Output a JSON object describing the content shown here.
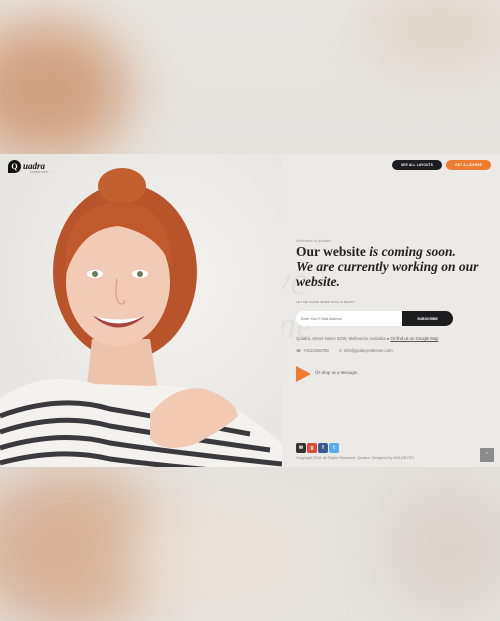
{
  "header": {
    "logo_mark": "Q",
    "logo_text": "uadra",
    "logo_sub": "COMING SOON",
    "see_layouts_label": "SEE ALL LAYOUTS",
    "license_label": "GET A LICENSE"
  },
  "watermark": {
    "line1": "Quadra Exclusive",
    "line2": "& Creative Theme"
  },
  "main": {
    "welcome": "Welcome to quadra",
    "headline_bold1": "Our website ",
    "headline_italic1": "is coming soon.",
    "headline_italic2": "We are currently working on our website."
  },
  "subscribe": {
    "notify_label": "LET ME KNOW WHEN SITE IS READY",
    "email_placeholder": "Enter Your E-Mail Address",
    "button_label": "SUBSCRIBE"
  },
  "contact": {
    "address": "Quadra, Street Name 6209, Melbourne Australia",
    "map_link": "Or find us on Google Map",
    "phone": "+0123456789",
    "email": "info@goldeyestheme.com",
    "drop_message": "Or drop us a message."
  },
  "social": {
    "colors": {
      "mail": "#333333",
      "google": "#dd4b39",
      "facebook": "#3b5998",
      "twitter": "#55acee"
    }
  },
  "footer": {
    "copyright": "Copyright 2018. All Rights Reserved. Quadra. Designed By GOLDEYES."
  },
  "accent": "#ee7b30"
}
